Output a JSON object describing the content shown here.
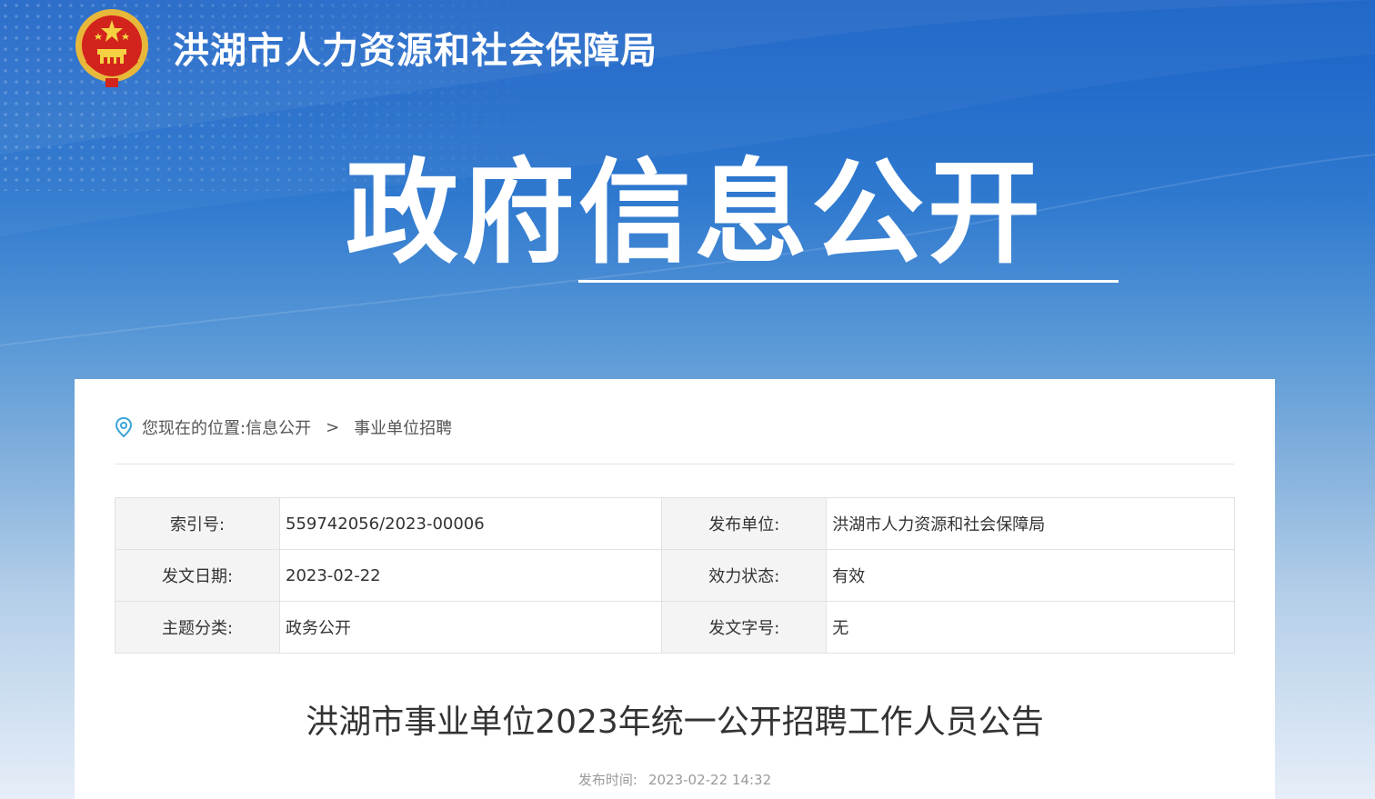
{
  "header": {
    "site_name": "洪湖市人力资源和社会保障局",
    "emblem_icon": "national-emblem-icon"
  },
  "banner": {
    "title": "政府信息公开"
  },
  "breadcrumb": {
    "prefix": "您现在的位置:",
    "items": [
      "信息公开",
      "事业单位招聘"
    ],
    "separator": ">",
    "icon": "location-pin-icon"
  },
  "meta_table": {
    "rows": [
      [
        {
          "label": "索引号:",
          "value": "559742056/2023-00006"
        },
        {
          "label": "发布单位:",
          "value": "洪湖市人力资源和社会保障局"
        }
      ],
      [
        {
          "label": "发文日期:",
          "value": "2023-02-22"
        },
        {
          "label": "效力状态:",
          "value": "有效"
        }
      ],
      [
        {
          "label": "主题分类:",
          "value": "政务公开"
        },
        {
          "label": "发文字号:",
          "value": "无"
        }
      ]
    ]
  },
  "article": {
    "title": "洪湖市事业单位2023年统一公开招聘工作人员公告",
    "publish_label": "发布时间:",
    "publish_time": "2023-02-22 14:32"
  },
  "colors": {
    "banner_top": "#1a62c6",
    "banner_bottom": "#e6eef8",
    "label_bg": "#f4f4f4",
    "border": "#e2e2e2",
    "pin_icon": "#3aa3d8"
  }
}
